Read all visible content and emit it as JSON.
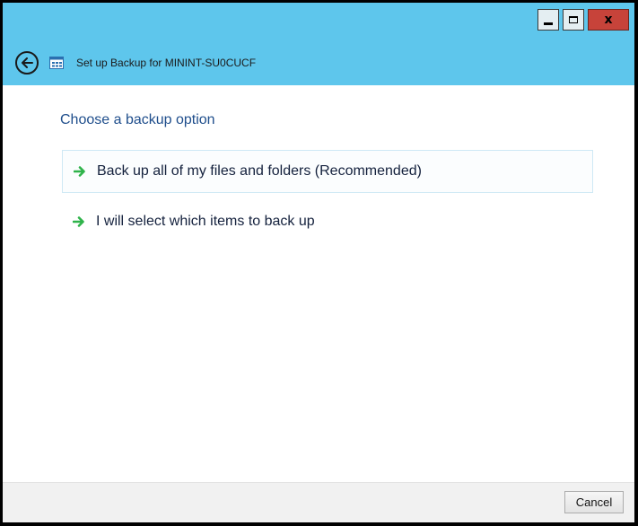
{
  "window": {
    "title": "Set up Backup for MININT-SU0CUCF",
    "caption": {
      "minimize_icon": "minimize-icon",
      "maximize_icon": "maximize-icon",
      "close_label": "x"
    }
  },
  "nav": {
    "back_icon": "back-arrow-icon",
    "app_icon": "control-panel-icon",
    "title": "Set up Backup for MININT-SU0CUCF"
  },
  "main": {
    "heading": "Choose a backup option",
    "options": [
      {
        "label": "Back up all of my files and folders (Recommended)",
        "icon": "green-arrow-icon",
        "highlighted": true
      },
      {
        "label": "I will select which items to back up",
        "icon": "green-arrow-icon",
        "highlighted": false
      }
    ]
  },
  "footer": {
    "cancel_label": "Cancel"
  },
  "colors": {
    "titlebar": "#5ec6ec",
    "heading": "#1f4e8c",
    "arrow": "#2fb34a",
    "close_button": "#c7433a"
  }
}
